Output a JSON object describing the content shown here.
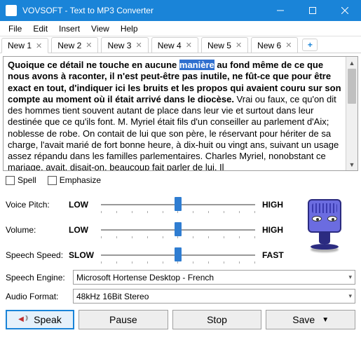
{
  "title": "VOVSOFT - Text to MP3 Converter",
  "menu": [
    "File",
    "Edit",
    "Insert",
    "View",
    "Help"
  ],
  "tabs": [
    {
      "label": "New 1",
      "active": true
    },
    {
      "label": "New 2",
      "active": false
    },
    {
      "label": "New 3",
      "active": false
    },
    {
      "label": "New 4",
      "active": false
    },
    {
      "label": "New 5",
      "active": false
    },
    {
      "label": "New 6",
      "active": false
    }
  ],
  "text": {
    "bold_pre": "Quoique ce détail ne touche en aucune ",
    "highlight": "manière",
    "bold_post": " au fond même de ce que nous avons à raconter, il n'est peut-être pas inutile, ne fût-ce que pour être exact en tout, d'indiquer ici les bruits et les propos qui avaient couru sur son compte au moment où il était arrivé dans le diocèse.",
    "rest": " Vrai ou faux, ce qu'on dit des hommes tient souvent autant de place dans leur vie et surtout dans leur destinée que ce qu'ils font. M. Myriel était fils d'un conseiller au parlement d'Aix; noblesse de robe. On contait de lui que son père, le réservant pour hériter de sa charge, l'avait marié de fort bonne heure, à dix-huit ou vingt ans, suivant un usage assez répandu dans les familles parlementaires. Charles Myriel, nonobstant ce mariage, avait, disait-on, beaucoup fait parler de lui. Il"
  },
  "checks": {
    "spell": "Spell",
    "emphasize": "Emphasize"
  },
  "sliders": {
    "pitch": {
      "label": "Voice Pitch:",
      "low": "LOW",
      "high": "HIGH",
      "pos": 50
    },
    "volume": {
      "label": "Volume:",
      "low": "LOW",
      "high": "HIGH",
      "pos": 50
    },
    "speed": {
      "label": "Speech Speed:",
      "low": "SLOW",
      "high": "FAST",
      "pos": 50
    }
  },
  "combos": {
    "engine": {
      "label": "Speech Engine:",
      "value": "Microsoft Hortense Desktop - French"
    },
    "format": {
      "label": "Audio Format:",
      "value": "48kHz 16Bit Stereo"
    }
  },
  "buttons": {
    "speak": "Speak",
    "pause": "Pause",
    "stop": "Stop",
    "save": "Save"
  }
}
